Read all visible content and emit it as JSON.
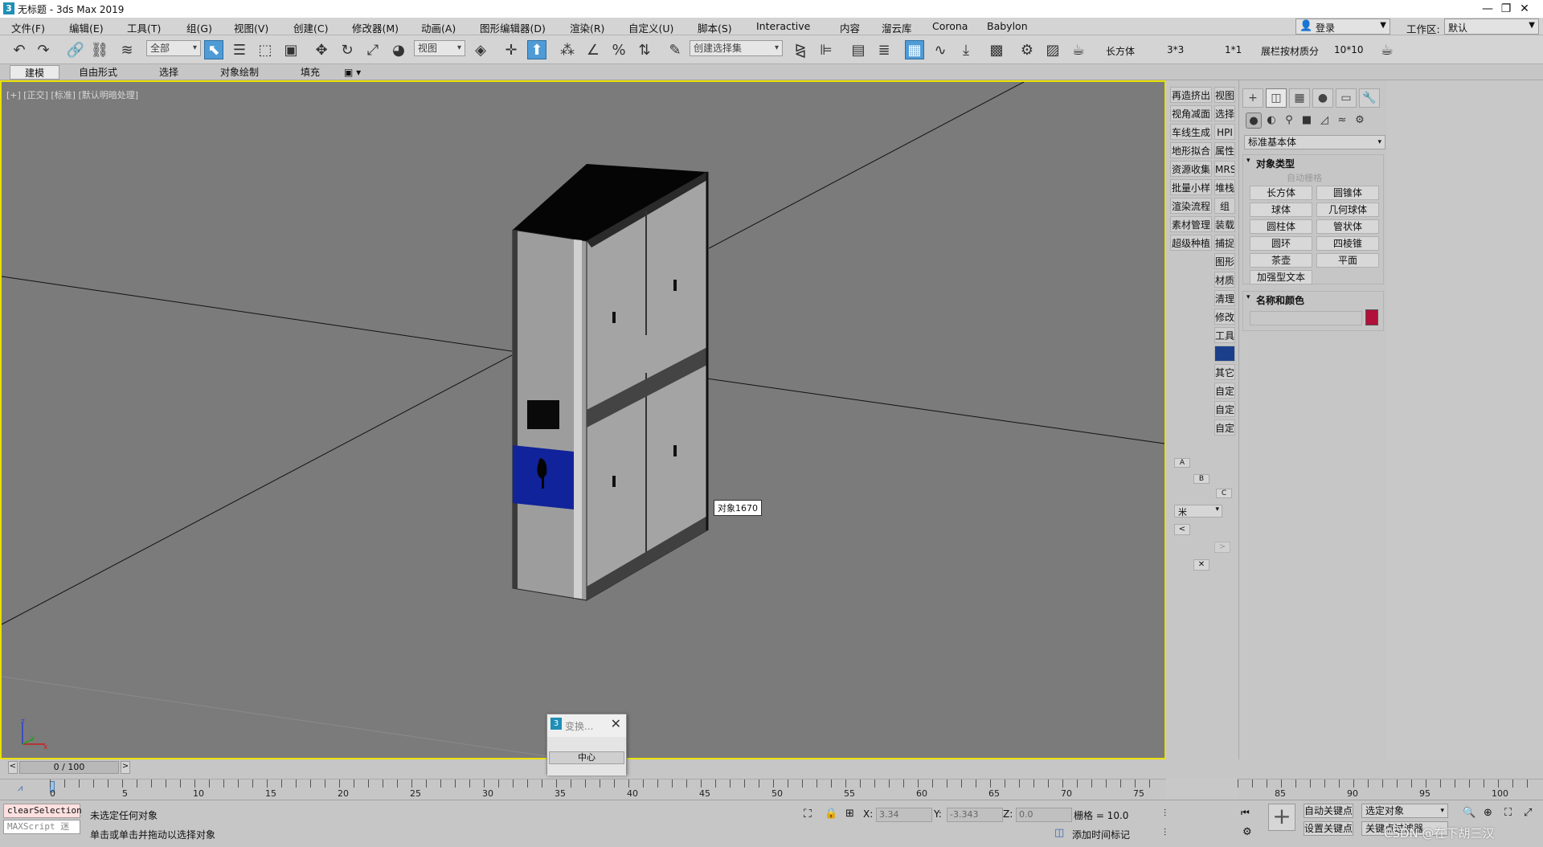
{
  "window": {
    "title": "无标题 - 3ds Max 2019",
    "app_icon": "3",
    "minimize": "—",
    "maximize": "❐",
    "close": "✕"
  },
  "menu": [
    "文件(F)",
    "编辑(E)",
    "工具(T)",
    "组(G)",
    "视图(V)",
    "创建(C)",
    "修改器(M)",
    "动画(A)",
    "图形编辑器(D)",
    "渲染(R)",
    "自定义(U)",
    "脚本(S)",
    "Interactive",
    "内容",
    "溜云库",
    "Corona",
    "Babylon"
  ],
  "account": {
    "login": "登录",
    "workspace_label": "工作区:",
    "workspace_value": "默认"
  },
  "toolbar": {
    "selection_filter": "全部",
    "ref_coord": "视图",
    "named_selection": "创建选择集",
    "labels": [
      "长方体",
      "3*3",
      "1*1",
      "展栏按材质分",
      "10*10"
    ]
  },
  "ribbon": {
    "tabs": [
      "建模",
      "自由形式",
      "选择",
      "对象绘制",
      "填充"
    ],
    "active_tab": "建模",
    "extra": "▣ ▾"
  },
  "viewport": {
    "label": "[+] [正交] [标准] [默认明暗处理]",
    "tooltip": "对象1670",
    "axis_z": "z",
    "axis_y": "y",
    "axis_x": "x",
    "border_color": "#e9e100",
    "bg_color": "#7b7b7b"
  },
  "cmd_strip": {
    "left": [
      "再造挤出",
      "视角减面",
      "车线生成",
      "地形拟合",
      "资源收集",
      "批量小样",
      "渲染流程",
      "素材管理",
      "超级种植"
    ],
    "right": [
      "视图",
      "选择",
      "HPI",
      "属性",
      "MRS",
      "堆栈",
      "组",
      "装载",
      "捕捉",
      "图形",
      "材质",
      "清理",
      "修改",
      "工具",
      "",
      "其它",
      "自定",
      "自定",
      "自定"
    ],
    "abc": [
      "A",
      "B",
      "C"
    ],
    "unit": "米",
    "prev": "<",
    "next": ">",
    "close": "✕"
  },
  "command_panel": {
    "tabs": [
      "+",
      "◫",
      "▦",
      "●",
      "▭",
      "🔧"
    ],
    "category": "标准基本体",
    "object_type_title": "对象类型",
    "auto_grid": "自动栅格",
    "primitives": [
      "长方体",
      "圆锥体",
      "球体",
      "几何球体",
      "圆柱体",
      "管状体",
      "圆环",
      "四棱锥",
      "茶壶",
      "平面"
    ],
    "extended_text": "加强型文本",
    "name_color_title": "名称和颜色",
    "object_color": "#b0103a"
  },
  "timeline": {
    "frame_counter": "0 / 100",
    "ticks": [
      "0",
      "5",
      "10",
      "15",
      "20",
      "25",
      "30",
      "35",
      "40",
      "45",
      "50",
      "55",
      "60",
      "65",
      "70",
      "75"
    ],
    "ticks_right": [
      "85",
      "90",
      "95",
      "100"
    ]
  },
  "status": {
    "maxscript_output": "clearSelection",
    "maxscript_input": "MAXScript 迷",
    "line1": "未选定任何对象",
    "line2": "单击或单击并拖动以选择对象",
    "x_label": "X:",
    "x_value": "3.34",
    "y_label": "Y:",
    "y_value": "-3.343",
    "z_label": "Z:",
    "z_value": "0.0",
    "grid": "栅格 = 10.0",
    "add_time_tag": "添加时间标记",
    "auto_key": "自动关键点",
    "set_key": "设置关键点",
    "key_target": "选定对象",
    "key_filter": "关键点过滤器",
    "watermark": "CSDN @在下胡三汉"
  },
  "dialog": {
    "title": "变换...",
    "button": "中心",
    "icon": "3"
  }
}
